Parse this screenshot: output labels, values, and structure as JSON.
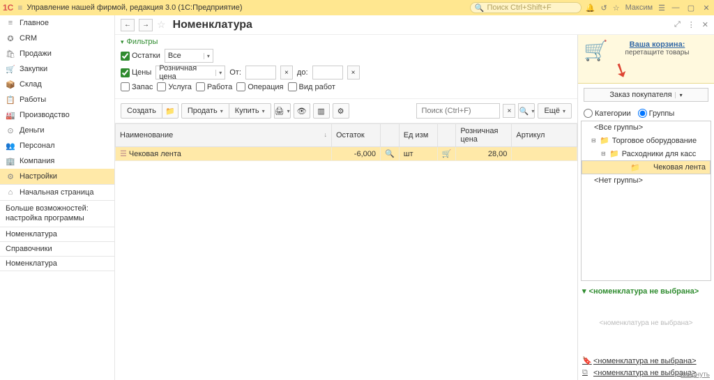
{
  "topbar": {
    "logo": "1С",
    "title": "Управление нашей фирмой, редакция 3.0  (1С:Предприятие)",
    "search_placeholder": "Поиск Ctrl+Shift+F",
    "user": "Максим"
  },
  "nav": {
    "items": [
      {
        "icon": "≡",
        "label": "Главное"
      },
      {
        "icon": "✪",
        "label": "CRM"
      },
      {
        "icon": "🛍",
        "label": "Продажи"
      },
      {
        "icon": "🛒",
        "label": "Закупки"
      },
      {
        "icon": "📦",
        "label": "Склад"
      },
      {
        "icon": "📋",
        "label": "Работы"
      },
      {
        "icon": "🏭",
        "label": "Производство"
      },
      {
        "icon": "⊙",
        "label": "Деньги"
      },
      {
        "icon": "👥",
        "label": "Персонал"
      },
      {
        "icon": "🏢",
        "label": "Компания"
      },
      {
        "icon": "⚙",
        "label": "Настройки"
      }
    ],
    "home": "Начальная страница",
    "extras": [
      "Больше возможностей: настройка программы",
      "Номенклатура",
      "Справочники",
      "Номенклатура"
    ]
  },
  "page": {
    "title": "Номенклатура"
  },
  "filters": {
    "title": "Фильтры",
    "ostatki": {
      "label": "Остатки",
      "value": "Все"
    },
    "ceny": {
      "label": "Цены",
      "value": "Розничная цена"
    },
    "ot": "От:",
    "do": "до:",
    "zapas": "Запас",
    "usluga": "Услуга",
    "rabota": "Работа",
    "operacia": "Операция",
    "vidrabot": "Вид работ"
  },
  "toolbar": {
    "create": "Создать",
    "sell": "Продать",
    "buy": "Купить",
    "search_placeholder": "Поиск (Ctrl+F)",
    "more": "Ещё"
  },
  "table": {
    "cols": {
      "name": "Наименование",
      "ostatok": "Остаток",
      "ed": "Ед изм",
      "price": "Розничная цена",
      "art": "Артикул"
    },
    "rows": [
      {
        "name": "Чековая лента",
        "ostatok": "-6,000",
        "ed": "шт",
        "price": "28,00",
        "art": ""
      }
    ]
  },
  "basket": {
    "title": "Ваша корзина:",
    "sub": "перетащите товары",
    "order": "Заказ покупателя"
  },
  "rswitch": {
    "cat": "Категории",
    "grp": "Группы"
  },
  "tree": {
    "all": "<Все группы>",
    "n1": "Торговое оборудование",
    "n2": "Расходники для касс",
    "n3": "Чековая лента",
    "nogrp": "<Нет группы>"
  },
  "selection": {
    "head": "<номенклатура не выбрана>",
    "empty": "<номенклатура не выбрана>",
    "link1": "<номенклатура не выбрана>",
    "link2": "<номенклатура не выбрана>"
  },
  "collapse": "свернуть"
}
